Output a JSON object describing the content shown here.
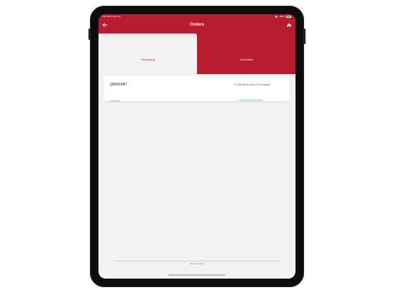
{
  "status_bar": {
    "time": "5:36 PM",
    "date": "Fri Mar 23",
    "wifi_icon": "wifi-icon",
    "battery_text": "100%",
    "battery_icon": "battery-icon"
  },
  "header": {
    "title": "Orders",
    "back_icon": "back-arrow-icon",
    "home_icon": "home-icon"
  },
  "tabs": [
    {
      "label": "Processing",
      "active": true
    },
    {
      "label": "Cancelled",
      "active": false
    }
  ],
  "orders": [
    {
      "id": "QN000087",
      "summary": "27.85 items from 2 Products"
    }
  ],
  "footer": {
    "text": "Nestle Connect"
  },
  "colors": {
    "brand_red": "#b81c2e",
    "background": "#f2f2f2",
    "active_tab_text": "#b81c2e"
  }
}
